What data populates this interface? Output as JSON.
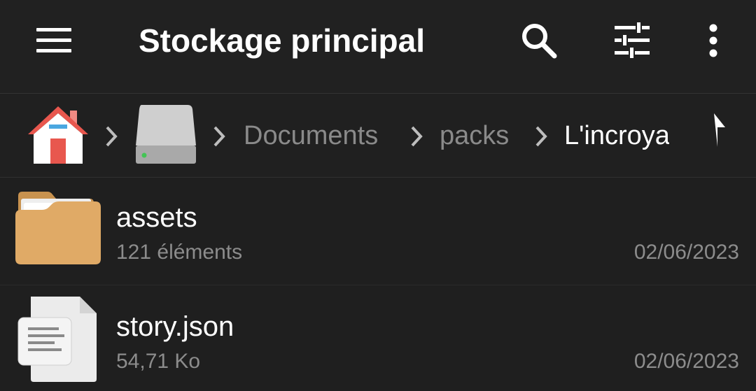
{
  "toolbar": {
    "title": "Stockage principal",
    "icons": {
      "menu": "menu-icon",
      "search": "search-icon",
      "filter": "sliders-icon",
      "more": "more-vertical-icon"
    }
  },
  "breadcrumb": {
    "items": [
      {
        "icon": "home-icon"
      },
      {
        "icon": "drive-icon"
      },
      {
        "label": "Documents"
      },
      {
        "label": "packs"
      },
      {
        "label": "L'incroya"
      }
    ],
    "up_icon": "arrow-up-icon"
  },
  "files": [
    {
      "name": "assets",
      "meta": "121 éléments",
      "date": "02/06/2023",
      "icon": "folder-icon"
    },
    {
      "name": "story.json",
      "meta": "54,71 Ko",
      "date": "02/06/2023",
      "icon": "document-icon"
    }
  ],
  "colors": {
    "background": "#1f1f1f",
    "toolbar": "#212121",
    "text_primary": "#ffffff",
    "text_secondary": "#8c8c8c",
    "folder": "#e0aa66",
    "home_roof": "#e8574e"
  }
}
